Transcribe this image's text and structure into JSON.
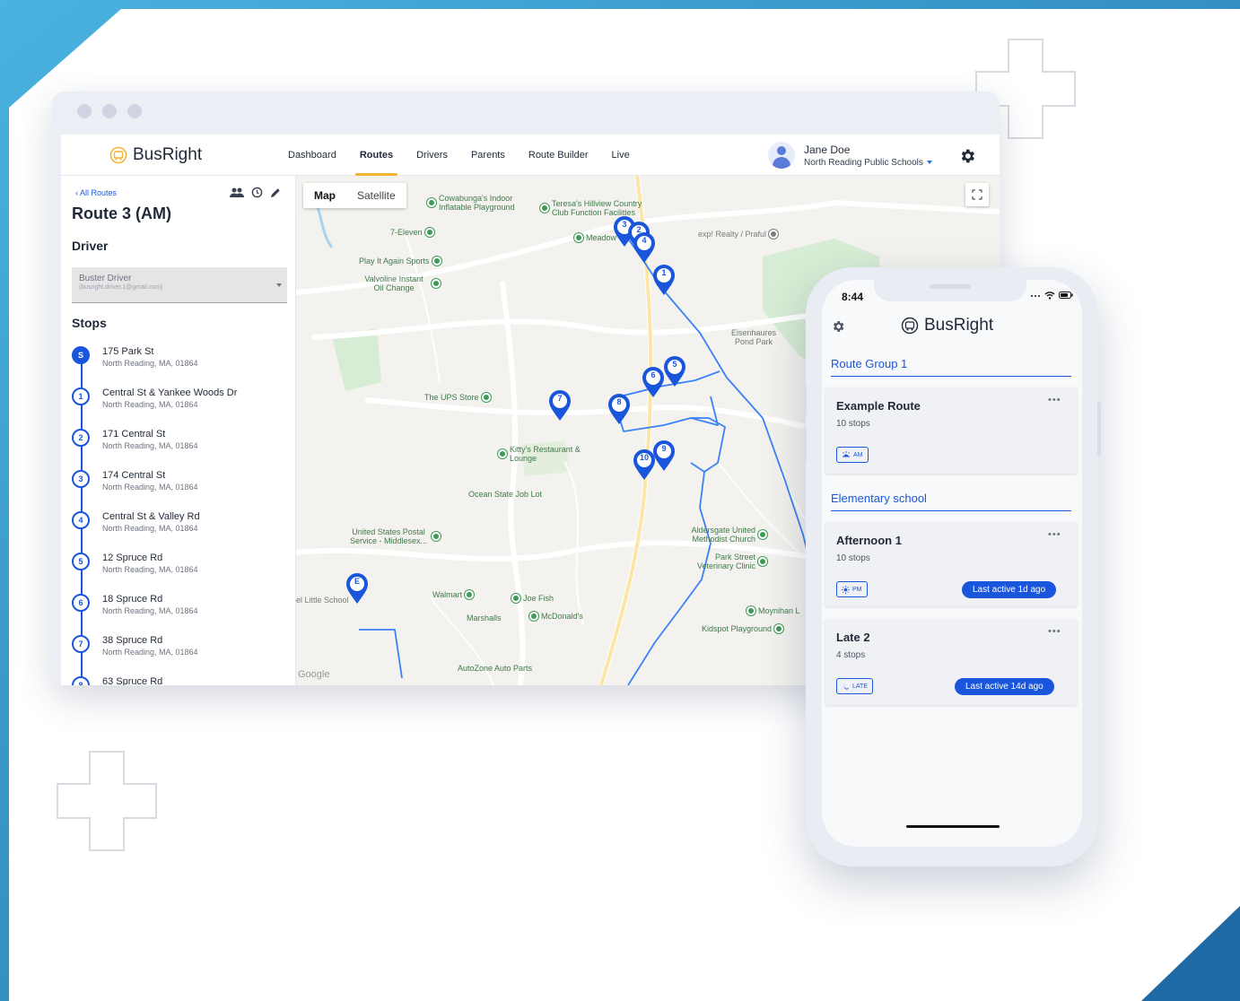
{
  "colors": {
    "brand_blue": "#1a56db",
    "nav_accent": "#f5b335",
    "route_line": "#3b82f6",
    "background_accent": "#2f8fcb",
    "park_green": "#d6ecd4"
  },
  "web": {
    "logo": "BusRight",
    "nav": [
      "Dashboard",
      "Routes",
      "Drivers",
      "Parents",
      "Route Builder",
      "Live"
    ],
    "nav_active": "Routes",
    "user": {
      "name": "Jane Doe",
      "org": "North Reading Public Schools"
    },
    "sidebar": {
      "back": "All Routes",
      "route_title": "Route 3 (AM)",
      "driver_heading": "Driver",
      "driver_name": "Buster Driver",
      "driver_email": "(busright.driver.1@gmail.com)",
      "stops_heading": "Stops",
      "stops": [
        {
          "marker": "S",
          "name": "175 Park St",
          "address": "North Reading, MA, 01864"
        },
        {
          "marker": "1",
          "name": "Central St & Yankee Woods Dr",
          "address": "North Reading, MA, 01864"
        },
        {
          "marker": "2",
          "name": "171 Central St",
          "address": "North Reading, MA, 01864"
        },
        {
          "marker": "3",
          "name": "174 Central St",
          "address": "North Reading, MA, 01864"
        },
        {
          "marker": "4",
          "name": "Central St & Valley Rd",
          "address": "North Reading, MA, 01864"
        },
        {
          "marker": "5",
          "name": "12 Spruce Rd",
          "address": "North Reading, MA, 01864"
        },
        {
          "marker": "6",
          "name": "18 Spruce Rd",
          "address": "North Reading, MA, 01864"
        },
        {
          "marker": "7",
          "name": "38 Spruce Rd",
          "address": "North Reading, MA, 01864"
        },
        {
          "marker": "8",
          "name": "63 Spruce Rd",
          "address": ""
        }
      ]
    },
    "map": {
      "map_button": "Map",
      "satellite_button": "Satellite",
      "pois": [
        "Cowabunga's Indoor Inflatable Playground",
        "Teresa's Hillview Country Club Function Facilities",
        "7-Eleven",
        "Meadow",
        "exp! Realty / Praful",
        "Play It Again Sports",
        "Valvoline Instant Oil Change",
        "Eisenhaures Pond Park",
        "The UPS Store",
        "Kitty's Restaurant & Lounge",
        "Ocean State Job Lot",
        "United States Postal Service - Middlesex...",
        "Aldersgate United Methodist Church",
        "Park Street Veterinary Clinic",
        "el Little School",
        "Walmart",
        "Joe Fish",
        "Marshalls",
        "McDonald's",
        "Moynihan L",
        "Kidspot Playground",
        "AutoZone Auto Parts"
      ],
      "markers": [
        "3",
        "2",
        "4",
        "1",
        "5",
        "6",
        "7",
        "8",
        "10",
        "9",
        "E"
      ],
      "attribution": "Google"
    }
  },
  "phone": {
    "time": "8:44",
    "logo": "BusRight",
    "groups": [
      {
        "title": "Route Group 1",
        "routes": [
          {
            "name": "Example Route",
            "stops": "10 stops",
            "tag": "AM",
            "icon": "sun-rise-icon",
            "active": ""
          }
        ]
      },
      {
        "title": "Elementary school",
        "routes": [
          {
            "name": "Afternoon 1",
            "stops": "10 stops",
            "tag": "PM",
            "icon": "sun-icon",
            "active": "Last active 1d ago"
          },
          {
            "name": "Late 2",
            "stops": "4 stops",
            "tag": "LATE",
            "icon": "moon-icon",
            "active": "Last active 14d ago"
          }
        ]
      }
    ],
    "more": "•••"
  }
}
